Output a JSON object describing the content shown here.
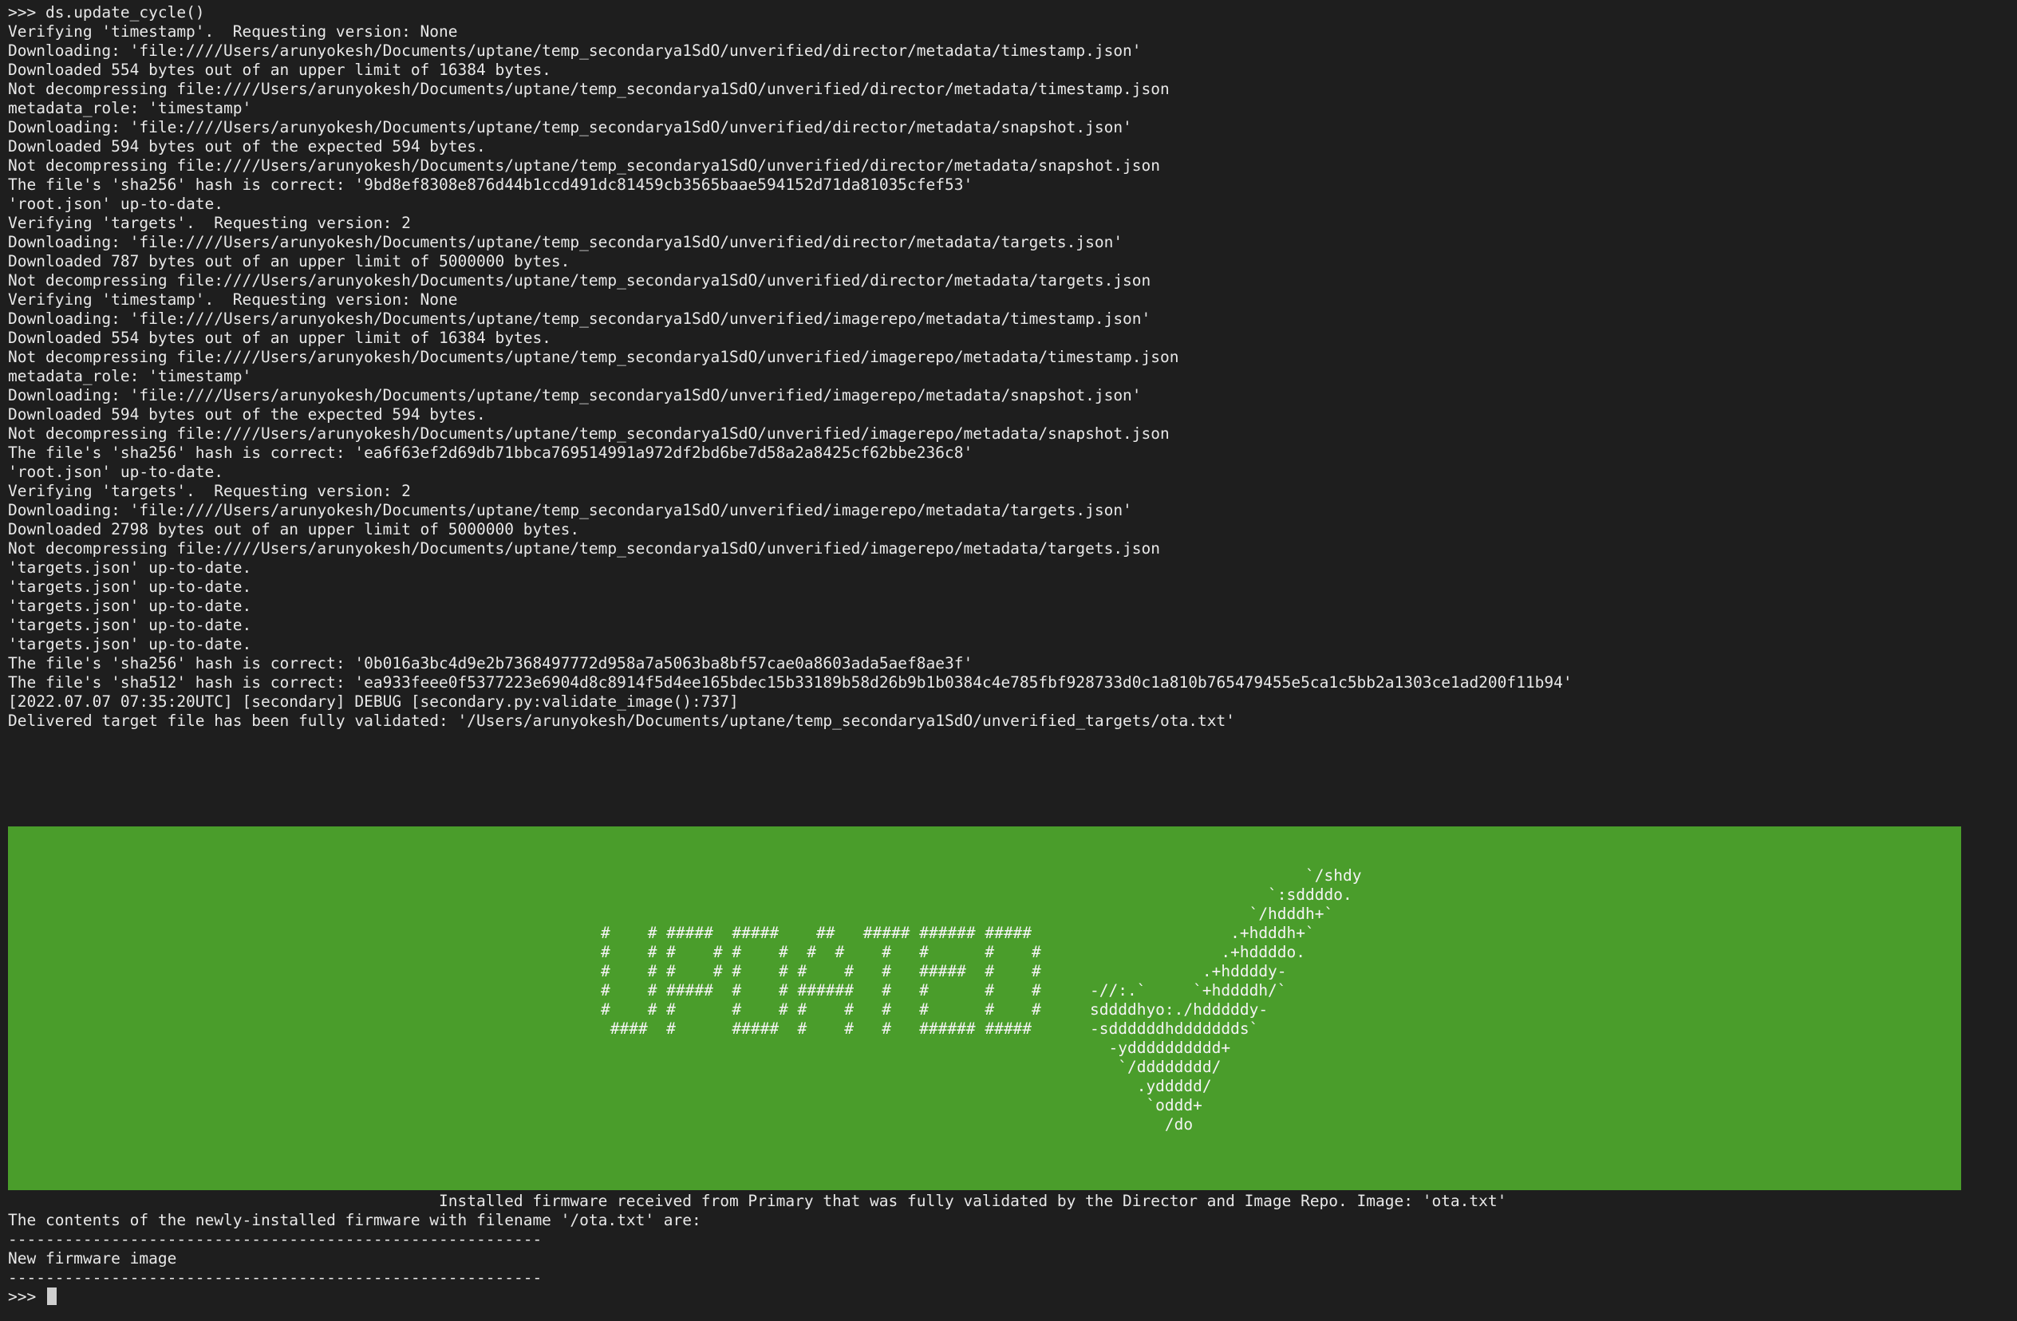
{
  "terminal": {
    "prompt": ">>> ",
    "command": "ds.update_cycle()",
    "log_lines": [
      "Verifying 'timestamp'.  Requesting version: None",
      "Downloading: 'file:////Users/arunyokesh/Documents/uptane/temp_secondarya1SdO/unverified/director/metadata/timestamp.json'",
      "Downloaded 554 bytes out of an upper limit of 16384 bytes.",
      "Not decompressing file:////Users/arunyokesh/Documents/uptane/temp_secondarya1SdO/unverified/director/metadata/timestamp.json",
      "metadata_role: 'timestamp'",
      "Downloading: 'file:////Users/arunyokesh/Documents/uptane/temp_secondarya1SdO/unverified/director/metadata/snapshot.json'",
      "Downloaded 594 bytes out of the expected 594 bytes.",
      "Not decompressing file:////Users/arunyokesh/Documents/uptane/temp_secondarya1SdO/unverified/director/metadata/snapshot.json",
      "The file's 'sha256' hash is correct: '9bd8ef8308e876d44b1ccd491dc81459cb3565baae594152d71da81035cfef53'",
      "'root.json' up-to-date.",
      "Verifying 'targets'.  Requesting version: 2",
      "Downloading: 'file:////Users/arunyokesh/Documents/uptane/temp_secondarya1SdO/unverified/director/metadata/targets.json'",
      "Downloaded 787 bytes out of an upper limit of 5000000 bytes.",
      "Not decompressing file:////Users/arunyokesh/Documents/uptane/temp_secondarya1SdO/unverified/director/metadata/targets.json",
      "Verifying 'timestamp'.  Requesting version: None",
      "Downloading: 'file:////Users/arunyokesh/Documents/uptane/temp_secondarya1SdO/unverified/imagerepo/metadata/timestamp.json'",
      "Downloaded 554 bytes out of an upper limit of 16384 bytes.",
      "Not decompressing file:////Users/arunyokesh/Documents/uptane/temp_secondarya1SdO/unverified/imagerepo/metadata/timestamp.json",
      "metadata_role: 'timestamp'",
      "Downloading: 'file:////Users/arunyokesh/Documents/uptane/temp_secondarya1SdO/unverified/imagerepo/metadata/snapshot.json'",
      "Downloaded 594 bytes out of the expected 594 bytes.",
      "Not decompressing file:////Users/arunyokesh/Documents/uptane/temp_secondarya1SdO/unverified/imagerepo/metadata/snapshot.json",
      "The file's 'sha256' hash is correct: 'ea6f63ef2d69db71bbca769514991a972df2bd6be7d58a2a8425cf62bbe236c8'",
      "'root.json' up-to-date.",
      "Verifying 'targets'.  Requesting version: 2",
      "Downloading: 'file:////Users/arunyokesh/Documents/uptane/temp_secondarya1SdO/unverified/imagerepo/metadata/targets.json'",
      "Downloaded 2798 bytes out of an upper limit of 5000000 bytes.",
      "Not decompressing file:////Users/arunyokesh/Documents/uptane/temp_secondarya1SdO/unverified/imagerepo/metadata/targets.json",
      "'targets.json' up-to-date.",
      "'targets.json' up-to-date.",
      "'targets.json' up-to-date.",
      "'targets.json' up-to-date.",
      "'targets.json' up-to-date.",
      "The file's 'sha256' hash is correct: '0b016a3bc4d9e2b7368497772d958a7a5063ba8bf57cae0a8603ada5aef8ae3f'",
      "The file's 'sha512' hash is correct: 'ea933feee0f5377223e6904d8c8914f5d4ee165bdec15b33189b58d26b9b1b0384c4e785fbf928733d0c1a810b765479455e5ca1c5bb2a1303ce1ad200f11b94'",
      "[2022.07.07 07:35:20UTC] [secondary] DEBUG [secondary.py:validate_image():737]",
      "Delivered target file has been fully validated: '/Users/arunyokesh/Documents/uptane/temp_secondarya1SdO/unverified_targets/ota.txt'"
    ],
    "banner": {
      "background": "#4a9d2b",
      "text_lines": [
        "#    # #####  #####    ##   ##### ###### #####",
        "#    # #    # #    #  #  #    #   #      #    #",
        "#    # #    # #    # #    #   #   #####  #    #",
        "#    # #####  #    # ######   #   #      #    #",
        "#    # #      #    # #    #   #   #      #    #",
        " ####  #      #####  #    #   #   ###### #####"
      ],
      "logo_lines": [
        "                       `/shdy",
        "                   `:sddddo.",
        "                 `/hdddh+`",
        "               .+hdddh+`",
        "              .+hddddo.",
        "            .+hddddy-",
        "-//:.`     `+hddddh/`",
        "sddddhyo:./hdddddy-",
        "-sddddddhddddddds`",
        "  -ydddddddddd+",
        "   `/dddddddd/",
        "     .yddddd/",
        "      `oddd+",
        "        /do"
      ]
    },
    "installed_message": "Installed firmware received from Primary that was fully validated by the Director and Image Repo. Image: 'ota.txt'",
    "contents_header": "The contents of the newly-installed firmware with filename '/ota.txt' are:",
    "separator": "---------------------------------------------------------",
    "firmware_content": "New firmware image",
    "final_prompt": ">>> "
  }
}
